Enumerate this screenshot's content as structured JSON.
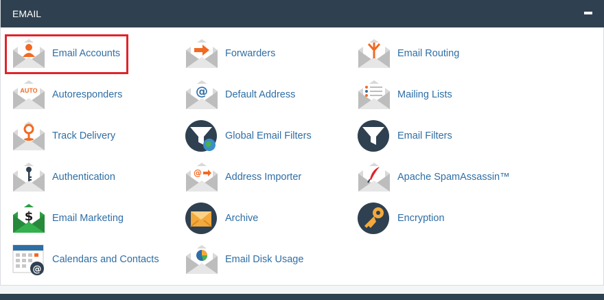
{
  "section": {
    "title": "EMAIL",
    "collapse_symbol": "−"
  },
  "items": [
    {
      "label": "Email Accounts",
      "icon": "envelope-user-icon"
    },
    {
      "label": "Forwarders",
      "icon": "envelope-arrow-icon"
    },
    {
      "label": "Email Routing",
      "icon": "envelope-routing-icon"
    },
    {
      "label": "Autoresponders",
      "icon": "envelope-auto-icon",
      "badge": "AUTO"
    },
    {
      "label": "Default Address",
      "icon": "envelope-at-icon"
    },
    {
      "label": "Mailing Lists",
      "icon": "envelope-list-icon"
    },
    {
      "label": "Track Delivery",
      "icon": "envelope-pin-icon"
    },
    {
      "label": "Global Email Filters",
      "icon": "funnel-globe-icon"
    },
    {
      "label": "Email Filters",
      "icon": "funnel-icon"
    },
    {
      "label": "Authentication",
      "icon": "envelope-key-icon"
    },
    {
      "label": "Address Importer",
      "icon": "envelope-import-icon"
    },
    {
      "label": "Apache SpamAssassin™",
      "icon": "envelope-feather-icon"
    },
    {
      "label": "Email Marketing",
      "icon": "envelope-dollar-icon"
    },
    {
      "label": "Archive",
      "icon": "archive-icon"
    },
    {
      "label": "Encryption",
      "icon": "encryption-key-icon"
    },
    {
      "label": "Calendars and Contacts",
      "icon": "calendar-at-icon"
    },
    {
      "label": "Email Disk Usage",
      "icon": "envelope-pie-icon"
    }
  ],
  "colors": {
    "header_bg": "#2f4050",
    "link": "#2f6ea5",
    "accent_orange": "#f06a23",
    "highlight": "#e0232b",
    "dark_circle": "#2f4050"
  }
}
